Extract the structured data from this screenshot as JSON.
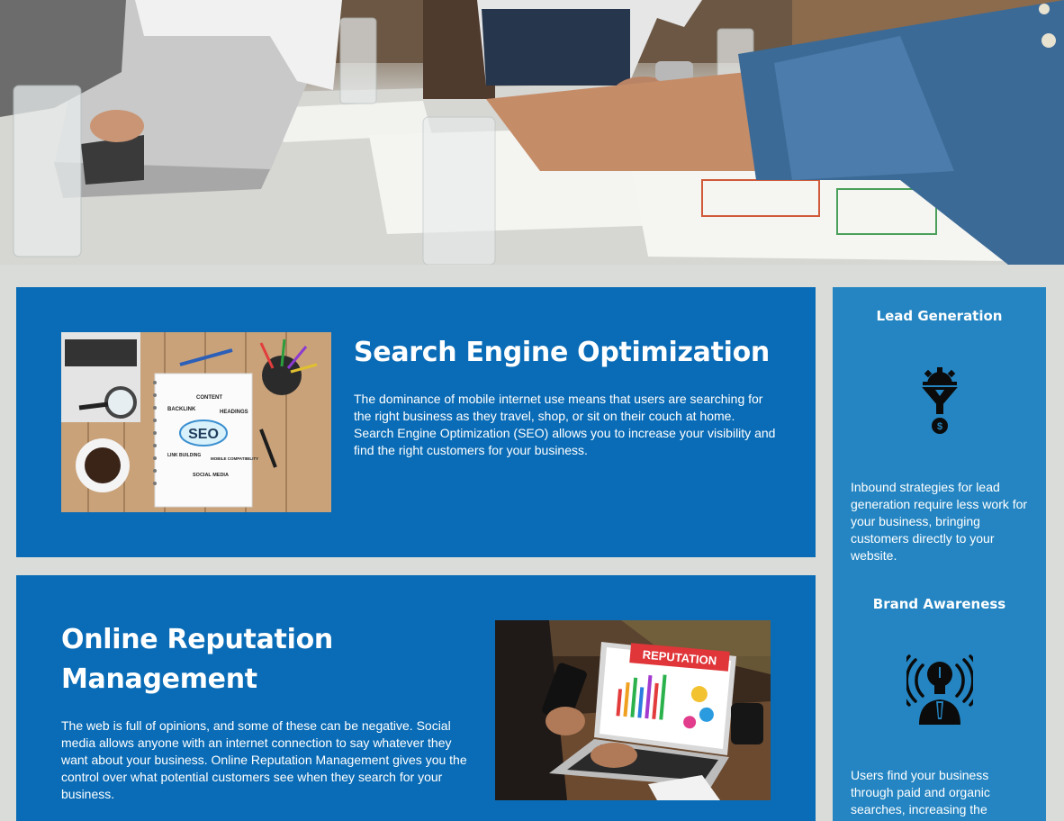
{
  "hero": {
    "image": "business-meeting-photo"
  },
  "seo": {
    "title": "Search Engine Optimization",
    "text": "The dominance of mobile internet use means that users are searching for the right business as they travel, shop, or sit on their couch at home. Search Engine Optimization (SEO) allows you to increase your visibility and find the right customers for your business.",
    "image": {
      "label": "SEO",
      "words": [
        "BACKLINK",
        "CONTENT",
        "HEADINGS",
        "LINK BUILDING",
        "MOBILE COMPATIBILITY",
        "SOCIAL MEDIA"
      ]
    }
  },
  "orm": {
    "title": "Online Reputation Management",
    "text": "The web is full of opinions, and some of these can be negative. Social media allows anyone with an internet connection to say whatever they want about your business. Online Reputation Management gives you the control over what potential customers see when they search for your business.",
    "image": {
      "label": "REPUTATION"
    }
  },
  "sidebar": {
    "lead": {
      "title": "Lead Generation",
      "icon": "funnel-gear-dollar-icon",
      "text": "Inbound strategies for lead generation require less work for your business, bringing customers directly to your website."
    },
    "brand": {
      "title": "Brand Awareness",
      "icon": "lightbulb-head-broadcast-icon",
      "text": "Users find your business through paid and organic searches, increasing the"
    }
  },
  "colors": {
    "page_bg": "#d9dcd8",
    "card_blue": "#0a6cb6",
    "sidebar_blue": "#2485c2"
  }
}
